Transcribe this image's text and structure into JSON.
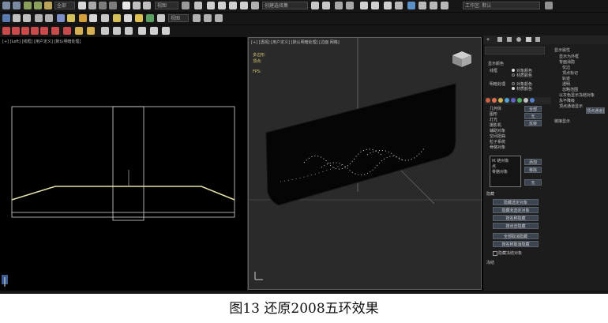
{
  "toolbar": {
    "row1_combo": "全部",
    "selection_set": "创建选择集",
    "workspace": "工作区: 默认",
    "row2_combo": "视图"
  },
  "viewport_left": {
    "label": "[+] [Left] [线框] [用户定义] [默认明暗处理]"
  },
  "viewport_persp": {
    "label": "[+] [透视] [用户定义] [默认明暗处理] [边面 网格]",
    "stats": [
      "多边形:",
      "顶点:"
    ],
    "fps": "FPS:"
  },
  "command_panel": {
    "display_props_title": "显示属性",
    "display_items": [
      "显示为外框",
      "背面消隐",
      "仅边",
      "顶点标记",
      "轨迹",
      "透明",
      "忽略范围",
      "以灰色显示冻结对象",
      "永不降级",
      "顶点通道显示"
    ],
    "rollout_display_color": "显示颜色",
    "wire_label": "线框",
    "shaded_label": "明暗处理",
    "opt_object_color": "对象颜色",
    "opt_material_color": "材质颜色",
    "hide_by_category": "按类别隐藏",
    "categories": [
      "几何体",
      "图形",
      "灯光",
      "摄影机",
      "辅助对象",
      "空间扭曲",
      "粒子系统",
      "骨骼对象"
    ],
    "all_btn": "全部",
    "none_btn": "无",
    "invert_btn": "反转",
    "add_btn": "添加",
    "remove_btn": "移除",
    "list_items": [
      "IK 链对象",
      "点",
      "骨骼对象"
    ],
    "hide_title": "隐藏",
    "hide_buttons": [
      "隐藏选定对象",
      "隐藏未选定对象",
      "按名称隐藏",
      "按点击隐藏",
      "全部取消隐藏",
      "按名称取消隐藏",
      "隐藏冻结对象"
    ],
    "freeze_title": "冻结",
    "link_display_title": "链接显示"
  },
  "caption": "图13 还原2008五环效果"
}
